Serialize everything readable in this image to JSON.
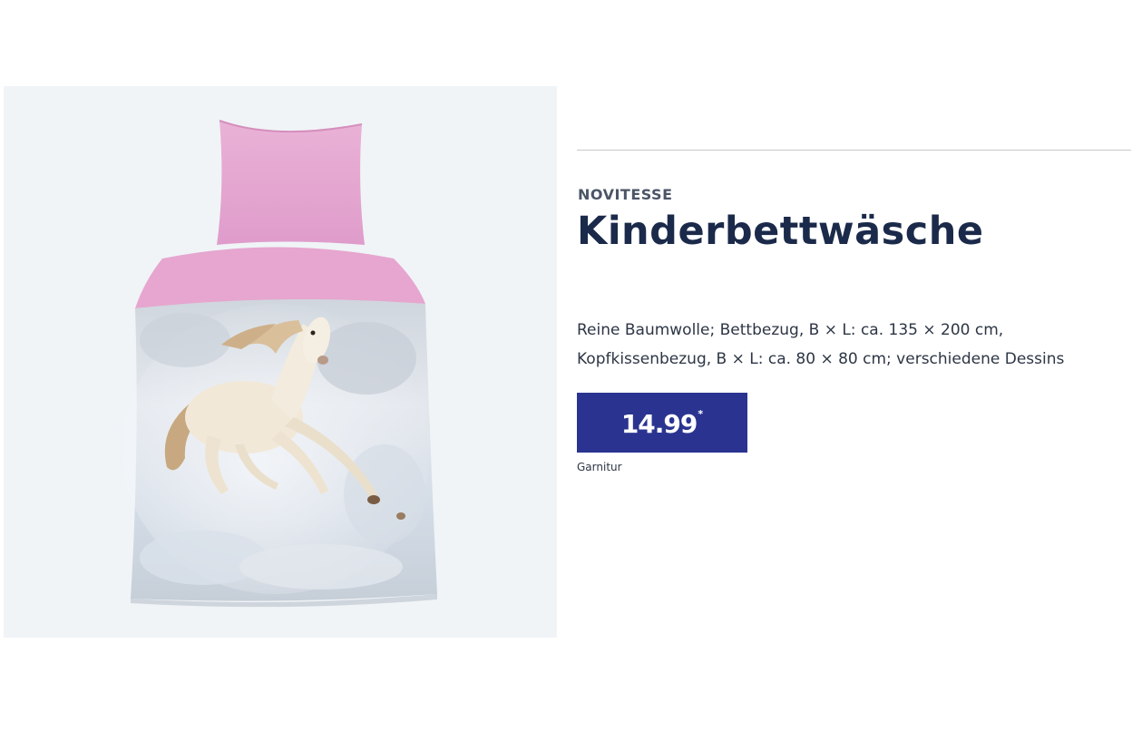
{
  "product": {
    "brand": "NOVITESSE",
    "title": "Kinderbettwäsche",
    "description_lines": [
      "Reine Baumwolle; Bettbezug, B × L: ca. 135 × 200 cm,",
      "Kopfkissenbezug, B × L: ca. 80 × 80 cm; verschiedene Dessins"
    ],
    "price": "14.99",
    "price_footnote_mark": "*",
    "price_unit": "Garnitur",
    "image": {
      "icon": "product-photo-bedding-horse",
      "colors": {
        "panel_background": "#f0f4f7",
        "pillow_pink": "#e8a6d0",
        "duvet_snow": "#d8dde6",
        "horse_cream": "#f1e8d8",
        "mane_tan": "#c8a880"
      }
    }
  },
  "colors": {
    "price_box": "#2a3490",
    "title_text": "#1b2a4a",
    "brand_text": "#4b5566",
    "divider": "#c8c8c8"
  }
}
